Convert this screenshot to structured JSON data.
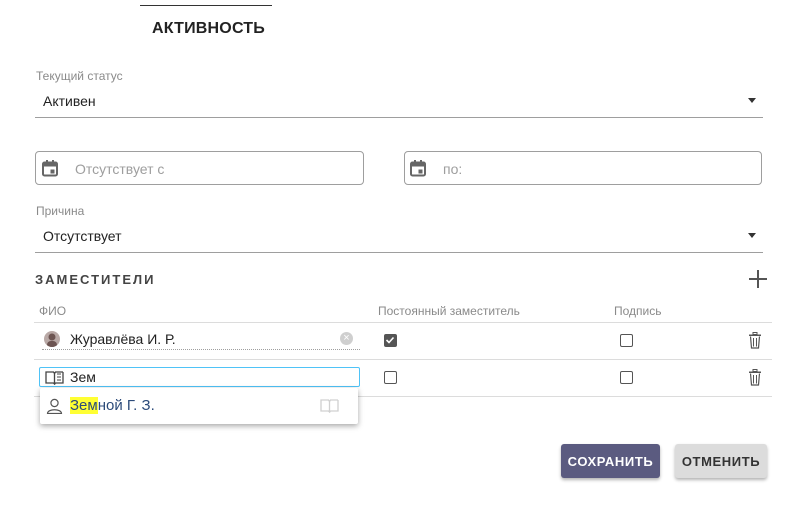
{
  "tab": {
    "label": "АКТИВНОСТЬ"
  },
  "status": {
    "label": "Текущий статус",
    "value": "Активен"
  },
  "absence": {
    "from_placeholder": "Отсутствует с",
    "to_placeholder": "по:"
  },
  "reason": {
    "label": "Причина",
    "value": "Отсутствует"
  },
  "deputies": {
    "title": "ЗАМЕСТИТЕЛИ",
    "columns": {
      "name": "ФИО",
      "permanent": "Постоянный заместитель",
      "signature": "Подпись"
    },
    "rows": [
      {
        "name": "Журавлёва И. Р.",
        "permanent": true,
        "signature": false
      },
      {
        "search_value": "Зем",
        "permanent": false,
        "signature": false
      }
    ],
    "suggestion": {
      "match": "Зем",
      "rest": "ной Г. З."
    }
  },
  "actions": {
    "save": "СОХРАНИТЬ",
    "cancel": "ОТМЕНИТЬ"
  },
  "colors": {
    "save_bg": "#5b5b80",
    "cancel_bg": "#dcdcdc",
    "highlight": "#ffff33",
    "focus": "#4fc3f7"
  },
  "icons": [
    "calendar-icon",
    "caret-down-icon",
    "plus-icon",
    "trash-icon",
    "clear-icon",
    "book-icon",
    "person-icon"
  ]
}
